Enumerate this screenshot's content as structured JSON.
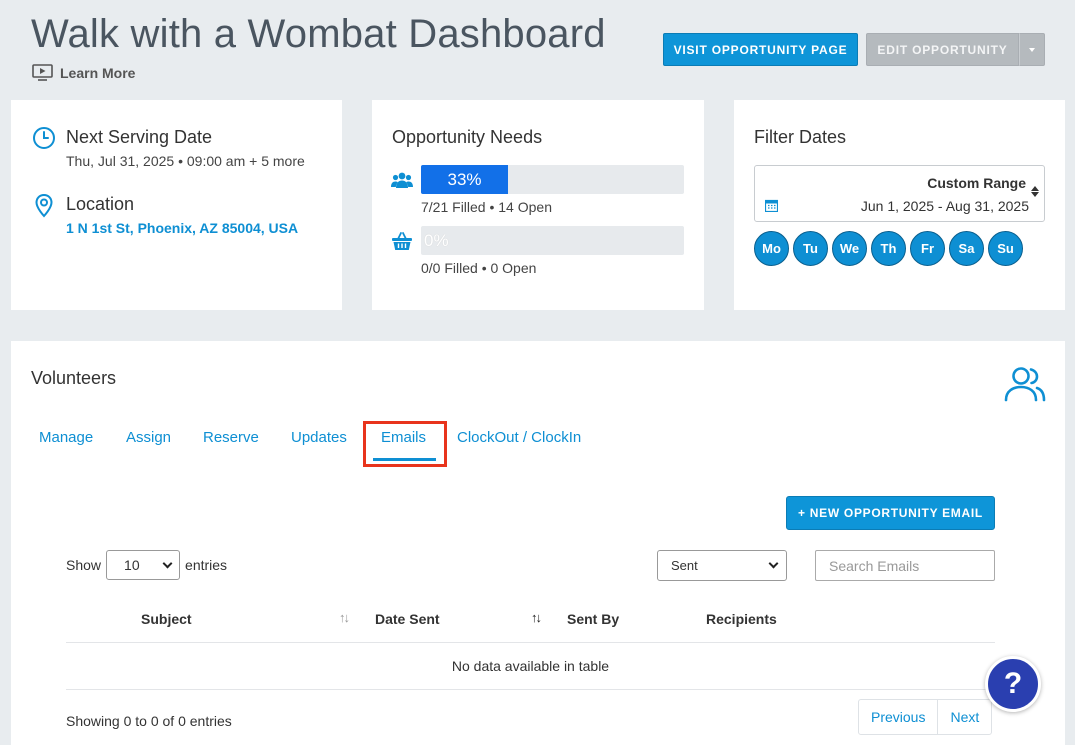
{
  "header": {
    "title": "Walk with a Wombat Dashboard",
    "learn_more": "Learn More",
    "visit_button": "VISIT OPPORTUNITY PAGE",
    "edit_button": "EDIT OPPORTUNITY"
  },
  "serving": {
    "next_date_label": "Next Serving Date",
    "next_date_value": "Thu, Jul 31, 2025 • 09:00 am + 5 more",
    "location_label": "Location",
    "location_value": "1 N 1st St, Phoenix, AZ 85004, USA"
  },
  "needs": {
    "title": "Opportunity Needs",
    "volunteers": {
      "percent_label": "33%",
      "fill_fraction": 0.33,
      "summary": "7/21 Filled • 14 Open"
    },
    "items": {
      "percent_label": "0%",
      "fill_fraction": 0,
      "summary": "0/0 Filled • 0 Open"
    }
  },
  "filter": {
    "title": "Filter Dates",
    "range_label": "Custom Range",
    "range_value": "Jun 1, 2025 - Aug 31, 2025",
    "days": [
      "Mo",
      "Tu",
      "We",
      "Th",
      "Fr",
      "Sa",
      "Su"
    ]
  },
  "volunteers": {
    "title": "Volunteers",
    "tabs": [
      "Manage",
      "Assign",
      "Reserve",
      "Updates",
      "Emails",
      "ClockOut / ClockIn"
    ],
    "active_tab": "Emails",
    "new_email_button": "+ NEW OPPORTUNITY EMAIL",
    "show_label": "Show",
    "entries_count": "10",
    "entries_label": "entries",
    "status_filter": "Sent",
    "search_placeholder": "Search Emails",
    "columns": [
      "Subject",
      "Date Sent",
      "Sent By",
      "Recipients"
    ],
    "empty_message": "No data available in table",
    "showing_text": "Showing 0 to 0 of 0 entries",
    "previous": "Previous",
    "next": "Next"
  },
  "help": {
    "label": "?"
  },
  "colors": {
    "accent": "#0e95d8",
    "bar_fill": "#1270e8",
    "highlight_box": "#e8341c",
    "help_button": "#2a3fb0"
  }
}
